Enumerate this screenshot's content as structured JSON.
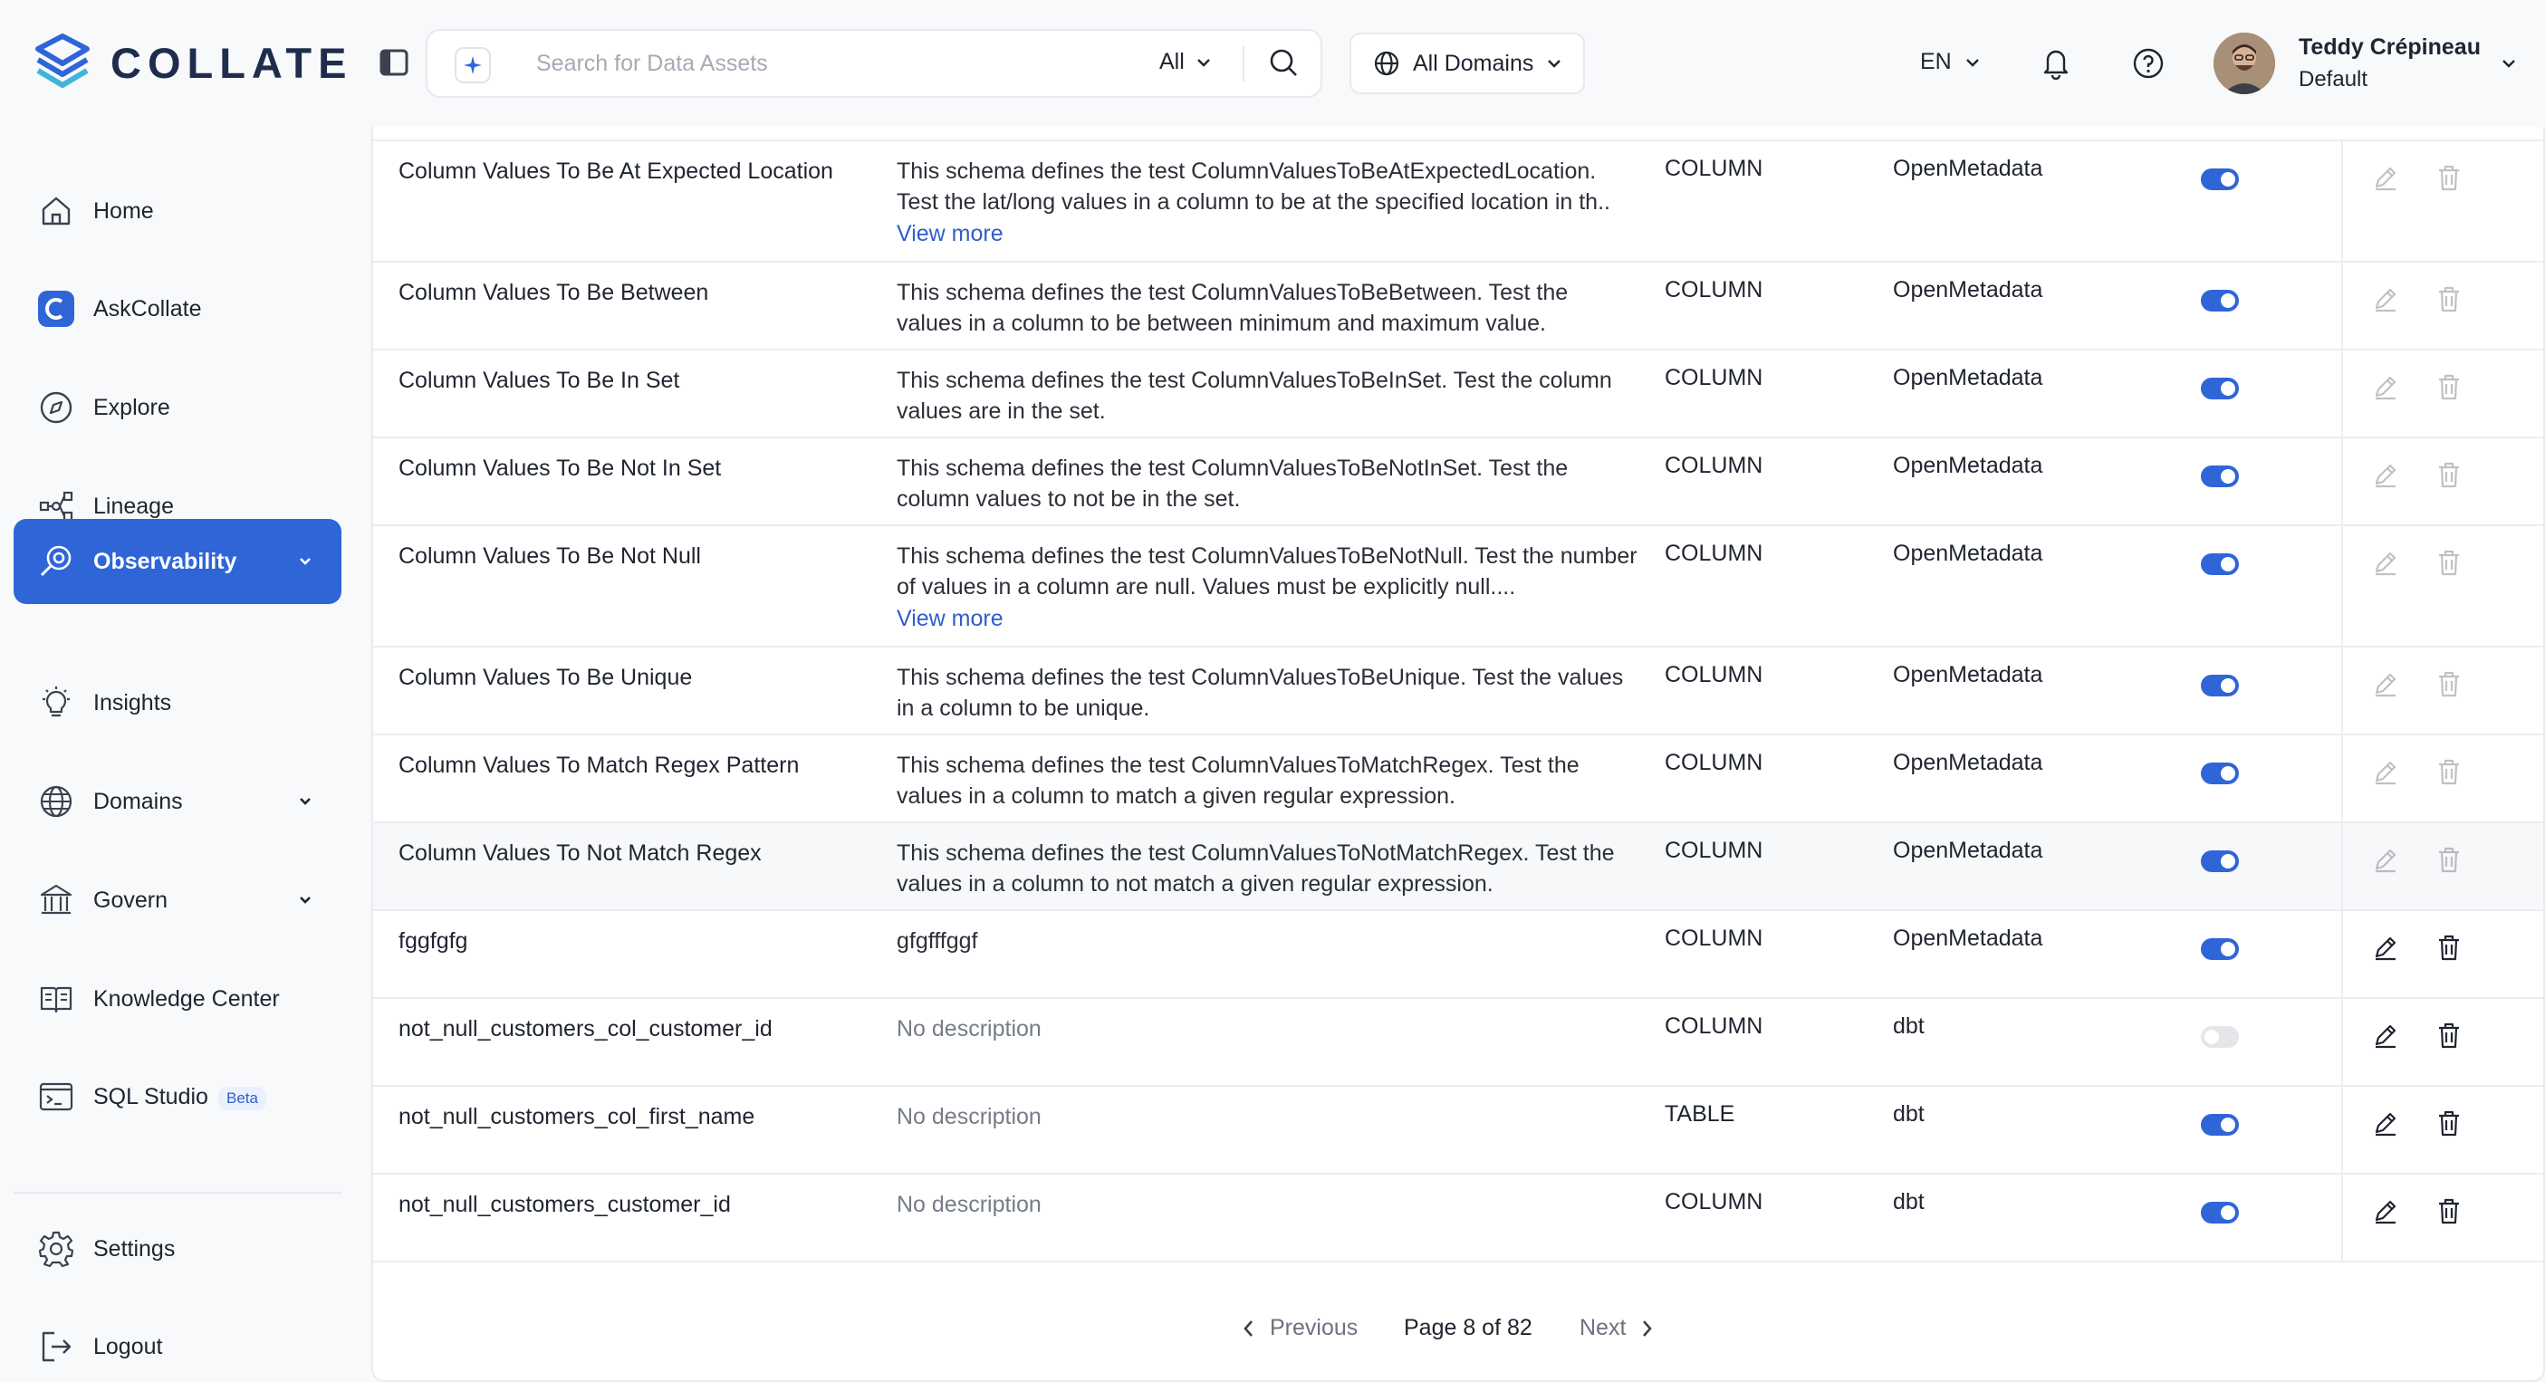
{
  "app": {
    "logo_text": "COLLATE"
  },
  "header": {
    "search_placeholder": "Search for Data Assets",
    "search_filter": "All",
    "domains": "All Domains",
    "language": "EN",
    "user_name": "Teddy Crépineau",
    "user_role": "Default"
  },
  "sidebar": {
    "items": [
      {
        "label": "Home",
        "icon": "home-icon"
      },
      {
        "label": "AskCollate",
        "icon": "askcollate-icon"
      },
      {
        "label": "Explore",
        "icon": "compass-icon"
      },
      {
        "label": "Lineage",
        "icon": "lineage-icon"
      },
      {
        "label": "Observability",
        "icon": "observability-icon"
      },
      {
        "label": "Insights",
        "icon": "lightbulb-icon"
      },
      {
        "label": "Domains",
        "icon": "globe-icon"
      },
      {
        "label": "Govern",
        "icon": "bank-icon"
      },
      {
        "label": "Knowledge Center",
        "icon": "book-icon"
      },
      {
        "label": "SQL Studio",
        "icon": "terminal-icon",
        "badge": "Beta"
      }
    ],
    "bottom": [
      {
        "label": "Settings",
        "icon": "gear-icon"
      },
      {
        "label": "Logout",
        "icon": "logout-icon"
      }
    ]
  },
  "table": {
    "rows": [
      {
        "name": "Column Values To Be At Expected Location",
        "description": "This schema defines the test ColumnValuesToBeAtExpectedLocation. Test the lat/long values in a column to be at the specified location in th..",
        "view_more": "View more",
        "type": "COLUMN",
        "provider": "OpenMetadata",
        "enabled": true,
        "editable": false
      },
      {
        "name": "Column Values To Be Between",
        "description": "This schema defines the test ColumnValuesToBeBetween. Test the values in a column to be between minimum and maximum value.",
        "type": "COLUMN",
        "provider": "OpenMetadata",
        "enabled": true,
        "editable": false
      },
      {
        "name": "Column Values To Be In Set",
        "description": "This schema defines the test ColumnValuesToBeInSet. Test the column values are in the set.",
        "type": "COLUMN",
        "provider": "OpenMetadata",
        "enabled": true,
        "editable": false
      },
      {
        "name": "Column Values To Be Not In Set",
        "description": "This schema defines the test ColumnValuesToBeNotInSet. Test the column values to not be in the set.",
        "type": "COLUMN",
        "provider": "OpenMetadata",
        "enabled": true,
        "editable": false
      },
      {
        "name": "Column Values To Be Not Null",
        "description": "This schema defines the test ColumnValuesToBeNotNull. Test the number of values in a column are null. Values must be explicitly null....",
        "view_more": "View more",
        "type": "COLUMN",
        "provider": "OpenMetadata",
        "enabled": true,
        "editable": false
      },
      {
        "name": "Column Values To Be Unique",
        "description": "This schema defines the test ColumnValuesToBeUnique. Test the values in a column to be unique.",
        "type": "COLUMN",
        "provider": "OpenMetadata",
        "enabled": true,
        "editable": false
      },
      {
        "name": "Column Values To Match Regex Pattern",
        "description": "This schema defines the test ColumnValuesToMatchRegex. Test the values in a column to match a given regular expression.",
        "type": "COLUMN",
        "provider": "OpenMetadata",
        "enabled": true,
        "editable": false
      },
      {
        "name": "Column Values To Not Match Regex",
        "description": "This schema defines the test ColumnValuesToNotMatchRegex. Test the values in a column to not match a given regular expression.",
        "type": "COLUMN",
        "provider": "OpenMetadata",
        "enabled": true,
        "editable": false
      },
      {
        "name": "fggfgfg",
        "description": "gfgfffggf",
        "type": "COLUMN",
        "provider": "OpenMetadata",
        "enabled": true,
        "editable": true
      },
      {
        "name": "not_null_customers_col_customer_id",
        "description": "No description",
        "type": "COLUMN",
        "provider": "dbt",
        "enabled": false,
        "editable": true
      },
      {
        "name": "not_null_customers_col_first_name",
        "description": "No description",
        "type": "TABLE",
        "provider": "dbt",
        "enabled": true,
        "editable": true
      },
      {
        "name": "not_null_customers_customer_id",
        "description": "No description",
        "type": "COLUMN",
        "provider": "dbt",
        "enabled": true,
        "editable": true
      }
    ]
  },
  "pagination": {
    "previous": "Previous",
    "page_info": "Page 8 of 82",
    "next": "Next"
  },
  "colors": {
    "accent": "#2f65d7",
    "background": "#f8f9fb",
    "link": "#2f5ec8"
  }
}
